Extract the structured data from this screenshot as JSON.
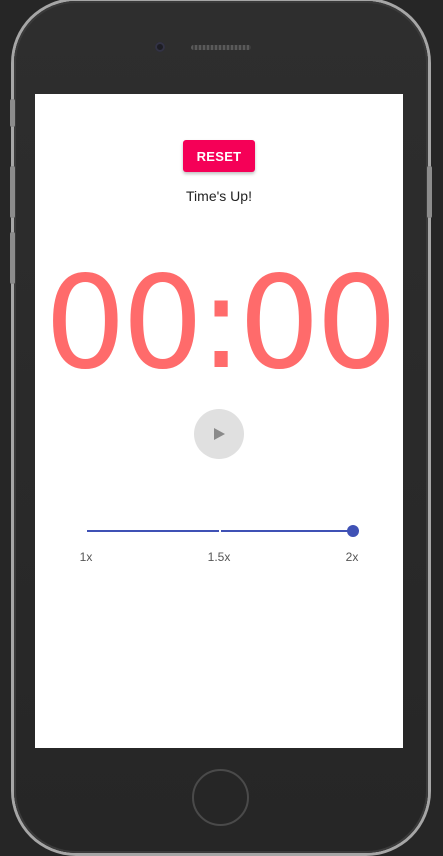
{
  "timer": {
    "reset_label": "RESET",
    "status_text": "Time's Up!",
    "time_display": "00:00",
    "time_color": "#ff6b6b",
    "play_icon": "play-icon"
  },
  "speed_slider": {
    "marks": [
      "1x",
      "1.5x",
      "2x"
    ],
    "selected": "2x",
    "accent_color": "#3f51b5"
  },
  "colors": {
    "reset_button": "#f50057",
    "play_button_bg": "#e0e0e0"
  }
}
